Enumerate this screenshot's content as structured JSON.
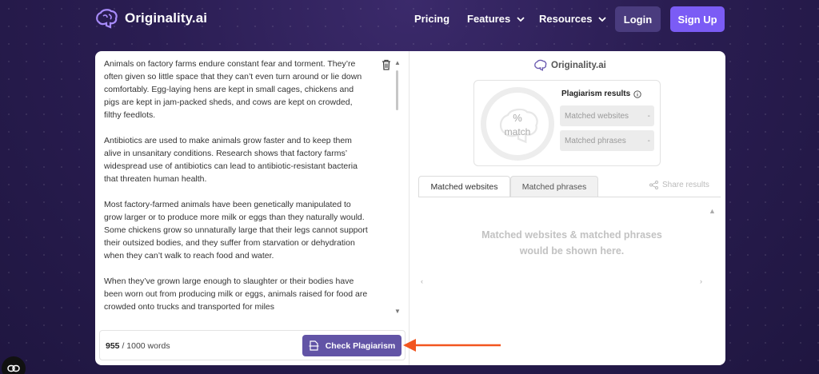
{
  "nav": {
    "brand": "Originality.ai",
    "links": [
      {
        "label": "Pricing"
      },
      {
        "label": "Features"
      },
      {
        "label": "Resources"
      }
    ],
    "login": "Login",
    "signup": "Sign Up"
  },
  "editor": {
    "paragraphs": [
      "Animals on factory farms endure constant fear and torment. They’re often given so little space that they can’t even turn around or lie down comfortably. Egg-laying hens are kept in small cages, chickens and pigs are kept in jam-packed sheds, and cows are kept on crowded, filthy feedlots.",
      "Antibiotics are used to make animals grow faster and to keep them alive in unsanitary conditions. Research shows that factory farms’ widespread use of antibiotics can lead to antibiotic-resistant bacteria that threaten human health.",
      "Most factory-farmed animals have been genetically manipulated to grow larger or to produce more milk or eggs than they naturally would. Some chickens grow so unnaturally large that their legs cannot support their outsized bodies, and they suffer from starvation or dehydration when they can’t walk to reach food and water.",
      "When they’ve grown large enough to slaughter or their bodies have been worn out from producing milk or eggs, animals raised for food are crowded onto trucks and transported for miles"
    ],
    "word_count": "955",
    "word_limit": " / 1000 words",
    "check_button": "Check Plagiarism"
  },
  "results": {
    "brand": "Originality.ai",
    "gauge_percent": "%",
    "gauge_label": "match",
    "title": "Plagiarism results",
    "matched_websites_label": "Matched websites",
    "matched_websites_value": "-",
    "matched_phrases_label": "Matched phrases",
    "matched_phrases_value": "-",
    "tabs": [
      {
        "label": "Matched websites",
        "active": true
      },
      {
        "label": "Matched phrases",
        "active": false
      }
    ],
    "share": "Share results",
    "placeholder": "Matched websites & matched phrases would be shown here."
  },
  "colors": {
    "primary": "#7b5cf5",
    "check_button": "#6254a6",
    "annotation_arrow": "#f2551f"
  }
}
